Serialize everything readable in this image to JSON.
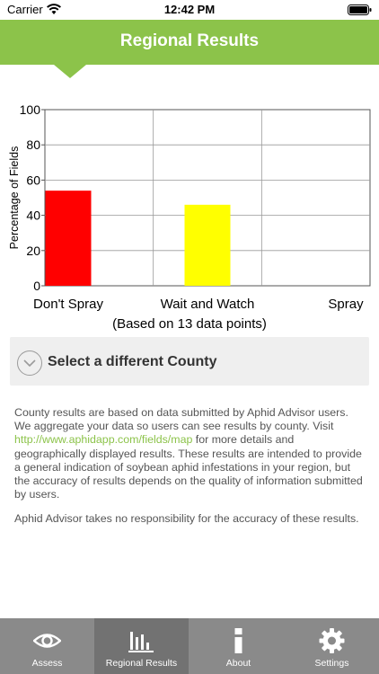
{
  "status_bar": {
    "carrier": "Carrier",
    "time": "12:42 PM"
  },
  "header": {
    "title": "Regional Results"
  },
  "chart_data": {
    "type": "bar",
    "categories": [
      "Don't Spray",
      "Wait and Watch",
      "Spray"
    ],
    "values": [
      54,
      46,
      0
    ],
    "colors": [
      "#ff0000",
      "#ffff00",
      "#00aa00"
    ],
    "ylabel": "Percentage of Fields",
    "ylim": [
      0,
      100
    ],
    "yticks": [
      "0",
      "20",
      "40",
      "60",
      "80",
      "100"
    ],
    "grid": true
  },
  "caption": "(Based on 13 data points)",
  "county_selector": {
    "label": "Select a different County",
    "icon": "chevron-down-circle-icon"
  },
  "info": {
    "text_before": "County results are based on data submitted by Aphid Advisor users. We aggregate your data so users can see results by county. Visit ",
    "link": "http://www.aphidapp.com/fields/map",
    "text_after": " for more details and geographically displayed results. These results are intended to provide a general indication of soybean aphid infestations in your region, but the accuracy of results depends on the quality of information submitted by users.",
    "disclaimer": "Aphid Advisor takes no responsibility for the accuracy of these results."
  },
  "tabs": [
    {
      "label": "Assess",
      "icon": "eye-icon",
      "active": false
    },
    {
      "label": "Regional Results",
      "icon": "bar-chart-icon",
      "active": true
    },
    {
      "label": "About",
      "icon": "info-icon",
      "active": false
    },
    {
      "label": "Settings",
      "icon": "gear-icon",
      "active": false
    }
  ],
  "colors": {
    "accent": "#8cc34a",
    "tab_bar": "#8a8a8a",
    "tab_active": "#727272"
  }
}
